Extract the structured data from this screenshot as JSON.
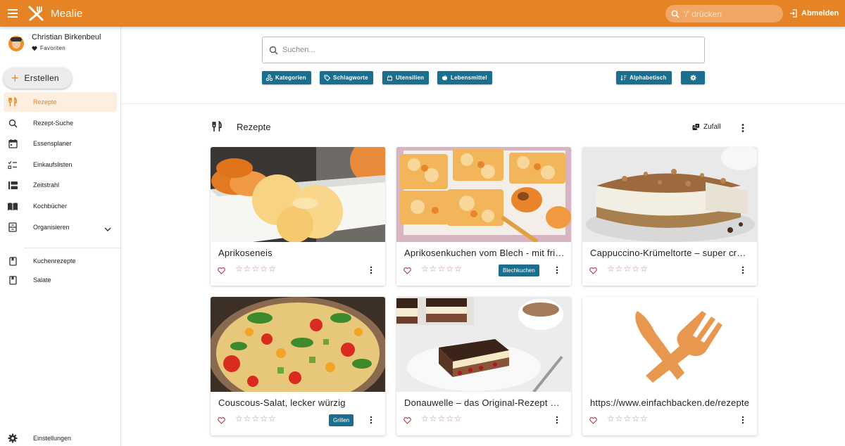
{
  "app": {
    "title": "Mealie"
  },
  "topbar": {
    "search_placeholder": "'/' drücken",
    "logout_label": "Abmelden"
  },
  "user": {
    "name": "Christian Birkenbeul",
    "favorites_label": "Favoriten"
  },
  "sidebar": {
    "create_label": "Erstellen",
    "items": [
      {
        "label": "Rezepte",
        "icon": "fork-knife-icon",
        "active": true
      },
      {
        "label": "Rezept-Suche",
        "icon": "search-icon"
      },
      {
        "label": "Essensplaner",
        "icon": "calendar-icon"
      },
      {
        "label": "Einkaufslisten",
        "icon": "checklist-icon"
      },
      {
        "label": "Zeitstrahl",
        "icon": "timeline-icon"
      },
      {
        "label": "Kochbücher",
        "icon": "book-open-icon"
      },
      {
        "label": "Organisieren",
        "icon": "cabinet-icon"
      }
    ],
    "cookbooks": [
      {
        "label": "Kuchenrezepte",
        "icon": "book-icon"
      },
      {
        "label": "Salate",
        "icon": "book-icon"
      }
    ],
    "settings_label": "Einstellungen"
  },
  "search": {
    "placeholder": "Suchen...",
    "chips": [
      "Kategorien",
      "Schlagworte",
      "Utensilien",
      "Lebensmittel"
    ],
    "sort_label": "Alphabetisch"
  },
  "section": {
    "title": "Rezepte",
    "random_label": "Zufall"
  },
  "recipes": [
    {
      "name": "Aprikoseneis",
      "tag": "",
      "rating": 0
    },
    {
      "name": "Aprikosenkuchen vom Blech - mit frischen Aprikosen",
      "tag": "Blechkuchen",
      "rating": 0
    },
    {
      "name": "Cappuccino-Krümeltorte – super cremig",
      "tag": "",
      "rating": 0
    },
    {
      "name": "Couscous-Salat, lecker würzig",
      "tag": "Grillen",
      "rating": 0
    },
    {
      "name": "Donauwelle – das Original-Rezept mit Kirschen",
      "tag": "",
      "rating": 0
    },
    {
      "name": "https://www.einfachbacken.de/rezepte",
      "tag": "",
      "rating": 0
    }
  ],
  "colors": {
    "brand": "#e58325",
    "accent": "#1a6f8f",
    "active_bg": "#fdeee0"
  }
}
